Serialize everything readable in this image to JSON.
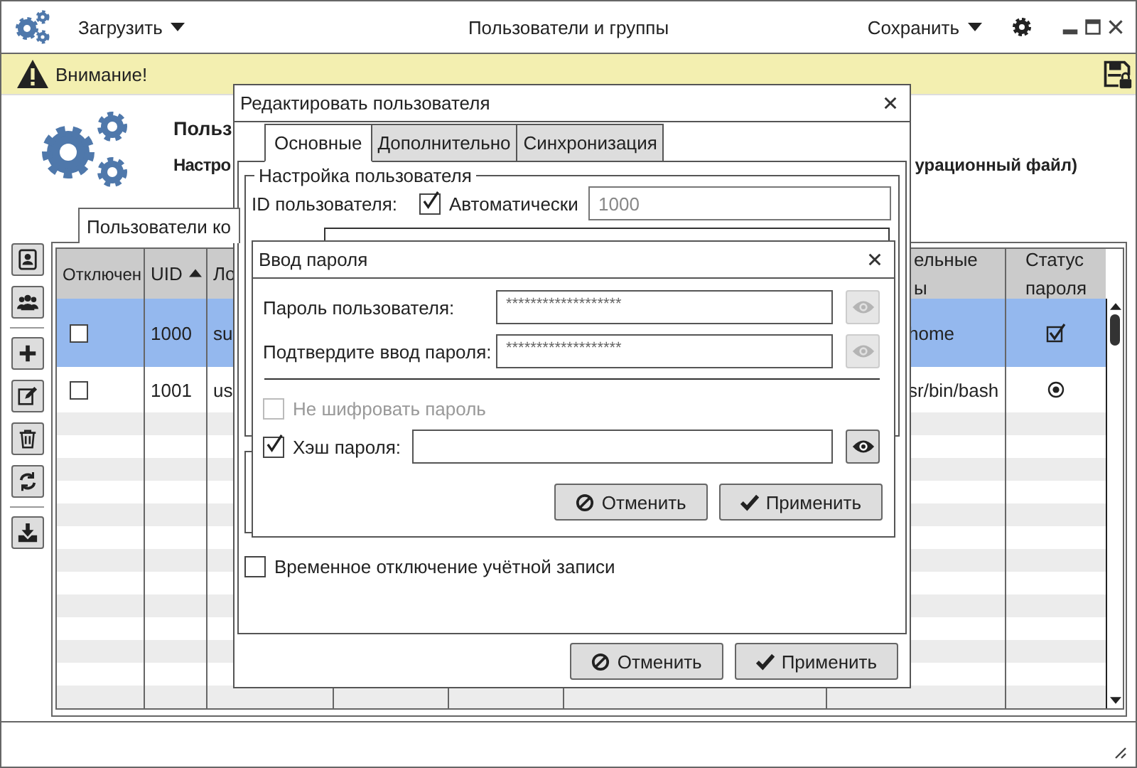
{
  "window": {
    "title": "Пользователи и группы",
    "load_menu": "Загрузить",
    "save_menu": "Сохранить"
  },
  "warning_bar": {
    "text": "Внимание!"
  },
  "header": {
    "title": "Польз",
    "subtitle": "Настро",
    "subtitle_tail": "урационный файл)"
  },
  "tabs": [
    {
      "label": "Пользователи ко",
      "selected": true
    }
  ],
  "table": {
    "columns": [
      {
        "label": "Отключен",
        "sorted": false
      },
      {
        "label": "UID",
        "sorted": true
      },
      {
        "label": "Ло",
        "sorted": false
      },
      {
        "label": "ельные\nы",
        "sorted": false
      },
      {
        "label": "Статус\nпароля",
        "sorted": false
      }
    ],
    "rows": [
      {
        "selected": true,
        "disabled": false,
        "uid": "1000",
        "login": "su",
        "shell": "home",
        "status_icon": {
          "kind": "check"
        }
      },
      {
        "selected": false,
        "disabled": false,
        "uid": "1001",
        "login": "us",
        "shell": "sr/bin/bash",
        "status_icon": {
          "kind": "dot"
        }
      }
    ]
  },
  "edit_dialog": {
    "title": "Редактировать пользователя",
    "tabs": [
      {
        "label": "Основные",
        "selected": true
      },
      {
        "label": "Дополнительно",
        "selected": false
      },
      {
        "label": "Синхронизация",
        "selected": false
      }
    ],
    "group_title": "Настройка пользователя",
    "uid_label": "ID пользователя:",
    "auto_uid": {
      "label": "Автоматически",
      "checked": true
    },
    "uid_value": "1000",
    "lock_account": {
      "label": "Временное отключение учётной записи",
      "checked": false
    },
    "buttons": [
      {
        "label": "Отменить",
        "kind": "cancel"
      },
      {
        "label": "Применить",
        "kind": "apply"
      }
    ]
  },
  "password_dialog": {
    "title": "Ввод пароля",
    "fields": [
      {
        "label": "Пароль пользователя:",
        "value": "*******************",
        "reveal_enabled": false
      },
      {
        "label": "Подтвердите ввод пароля:",
        "value": "*******************",
        "reveal_enabled": false
      }
    ],
    "no_encrypt": {
      "label": "Не шифровать пароль",
      "checked": false,
      "disabled": true
    },
    "hash": {
      "label": "Хэш пароля:",
      "checked": true,
      "reveal_enabled": true
    },
    "buttons": [
      {
        "label": "Отменить",
        "kind": "cancel"
      },
      {
        "label": "Применить",
        "kind": "apply"
      }
    ]
  }
}
